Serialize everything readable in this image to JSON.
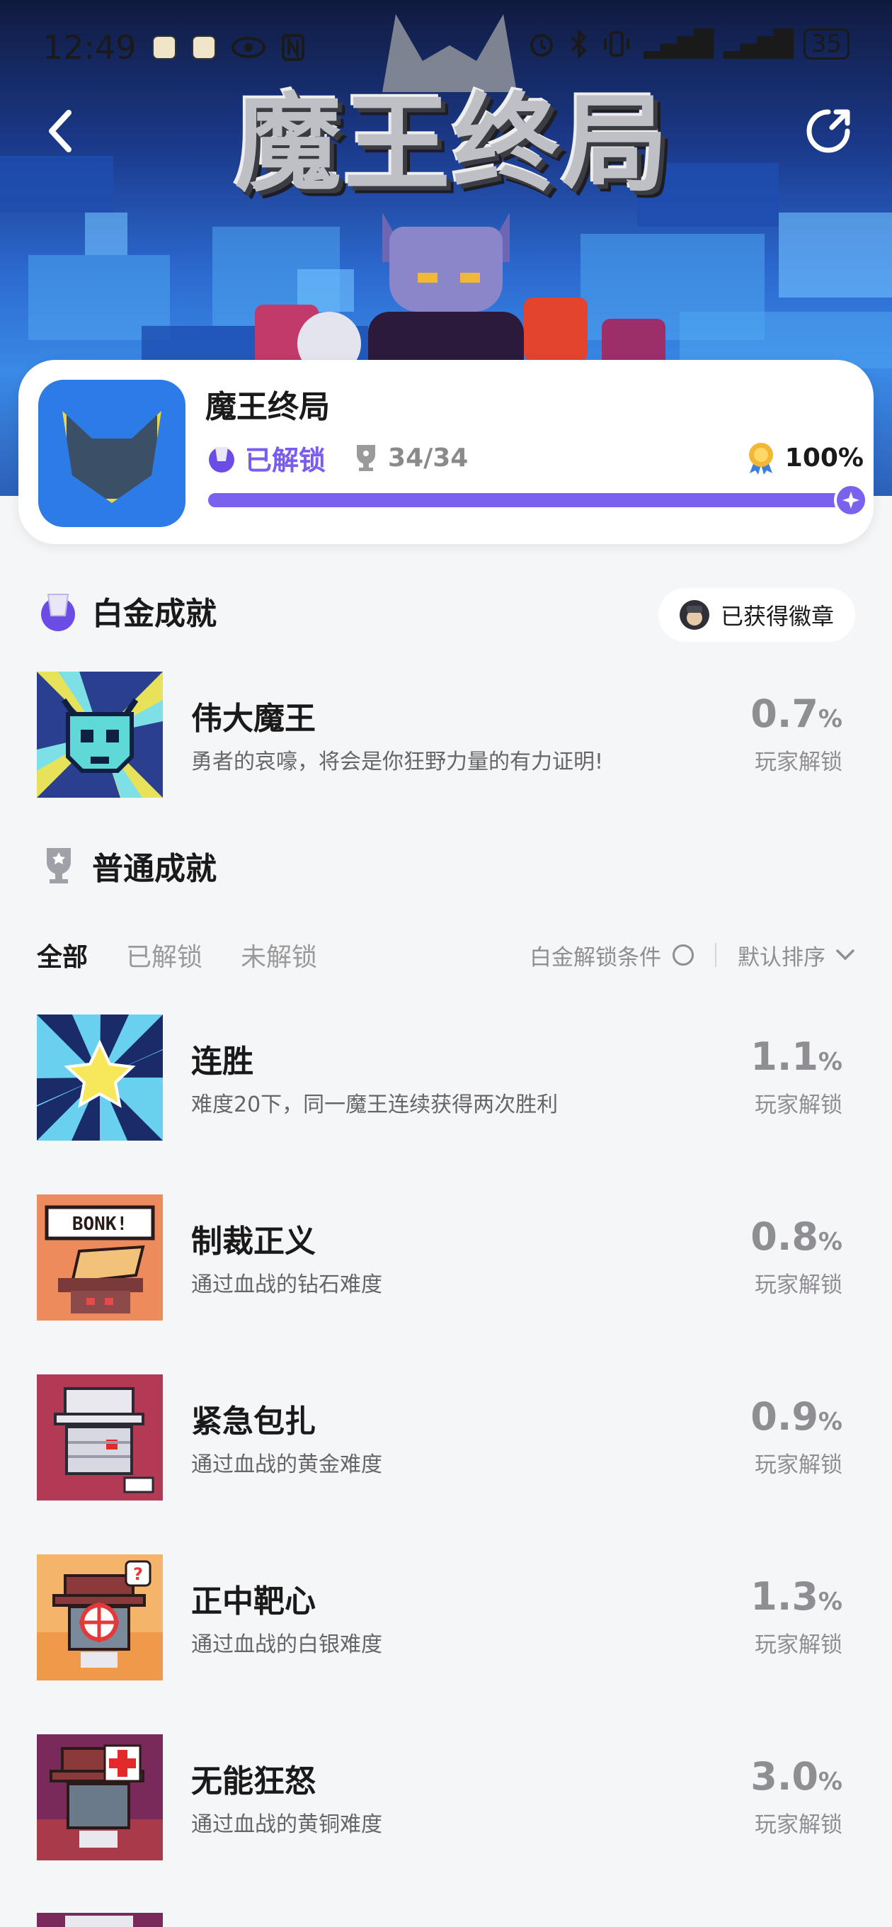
{
  "status_bar": {
    "time": "12:49",
    "battery": "35"
  },
  "hero": {
    "logo_text": "魔王终局"
  },
  "game": {
    "name": "魔王终局",
    "unlock_label": "已解锁",
    "trophy_count": "34/34",
    "percent": "100%",
    "progress": 1.0
  },
  "platinum": {
    "section_title": "白金成就",
    "badge_button_label": "已获得徽章",
    "achievement": {
      "title": "伟大魔王",
      "desc": "勇者的哀嚎，将会是你狂野力量的有力证明!",
      "rate": "0.7",
      "unit": "%",
      "rate_label": "玩家解锁"
    }
  },
  "normal": {
    "section_title": "普通成就",
    "tabs": [
      "全部",
      "已解锁",
      "未解锁"
    ],
    "platinum_condition_label": "白金解锁条件",
    "sort_label": "默认排序",
    "items": [
      {
        "title": "连胜",
        "desc": "难度20下，同一魔王连续获得两次胜利",
        "rate": "1.1",
        "unit": "%",
        "rate_label": "玩家解锁"
      },
      {
        "title": "制裁正义",
        "desc": "通过血战的钻石难度",
        "rate": "0.8",
        "unit": "%",
        "rate_label": "玩家解锁"
      },
      {
        "title": "紧急包扎",
        "desc": "通过血战的黄金难度",
        "rate": "0.9",
        "unit": "%",
        "rate_label": "玩家解锁"
      },
      {
        "title": "正中靶心",
        "desc": "通过血战的白银难度",
        "rate": "1.3",
        "unit": "%",
        "rate_label": "玩家解锁"
      },
      {
        "title": "无能狂怒",
        "desc": "通过血战的黄铜难度",
        "rate": "3.0",
        "unit": "%",
        "rate_label": "玩家解锁"
      }
    ]
  },
  "colors": {
    "accent": "#7b62ee",
    "rate_gray": "#8e8e93",
    "page_bg": "#f5f6f8"
  }
}
